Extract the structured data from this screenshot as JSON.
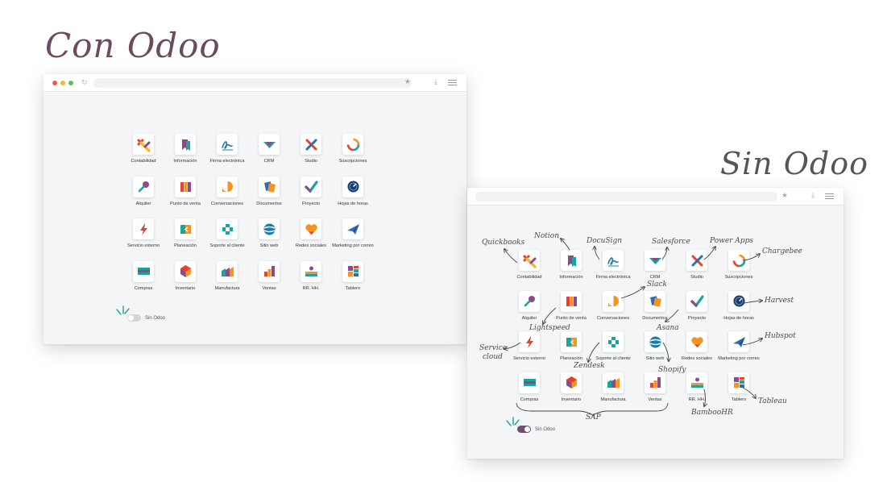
{
  "titles": {
    "con": "Con Odoo",
    "sin": "Sin Odoo"
  },
  "apps": [
    {
      "label": "Contabilidad",
      "icon": "contabilidad-icon"
    },
    {
      "label": "Información",
      "icon": "informacion-icon"
    },
    {
      "label": "Firma electrónica",
      "icon": "firma-electronica-icon"
    },
    {
      "label": "CRM",
      "icon": "crm-icon"
    },
    {
      "label": "Studio",
      "icon": "studio-icon"
    },
    {
      "label": "Suscripciones",
      "icon": "suscripciones-icon"
    },
    {
      "label": "Alquiler",
      "icon": "alquiler-icon"
    },
    {
      "label": "Punto de venta",
      "icon": "punto-de-venta-icon"
    },
    {
      "label": "Conversaciones",
      "icon": "conversaciones-icon"
    },
    {
      "label": "Documentos",
      "icon": "documentos-icon"
    },
    {
      "label": "Proyecto",
      "icon": "proyecto-icon"
    },
    {
      "label": "Hojas de horas",
      "icon": "hojas-de-horas-icon"
    },
    {
      "label": "Servicio externo",
      "icon": "servicio-externo-icon"
    },
    {
      "label": "Planeación",
      "icon": "planeacion-icon"
    },
    {
      "label": "Soporte al cliente",
      "icon": "soporte-al-cliente-icon"
    },
    {
      "label": "Sitio web",
      "icon": "sitio-web-icon"
    },
    {
      "label": "Redes sociales",
      "icon": "redes-sociales-icon"
    },
    {
      "label": "Marketing por correo",
      "icon": "marketing-por-correo-icon"
    },
    {
      "label": "Compras",
      "icon": "compras-icon"
    },
    {
      "label": "Inventario",
      "icon": "inventario-icon"
    },
    {
      "label": "Manufactura",
      "icon": "manufactura-icon"
    },
    {
      "label": "Ventas",
      "icon": "ventas-icon"
    },
    {
      "label": "RR. HH.",
      "icon": "rrhh-icon"
    },
    {
      "label": "Tablero",
      "icon": "tablero-icon"
    }
  ],
  "apps_sin_labels": {
    "Servicio externo": "Servicio externo",
    "Punto de venta": "Punto de venta",
    "Soporte al cliente": "Soporte al cliente"
  },
  "toggle": {
    "con_label": "Sin Odoo",
    "sin_label": "Sin Odoo",
    "con_state": "off",
    "sin_state": "on"
  },
  "tools": [
    {
      "name": "Quickbooks"
    },
    {
      "name": "Notion"
    },
    {
      "name": "DocuSign"
    },
    {
      "name": "Salesforce"
    },
    {
      "name": "Power Apps"
    },
    {
      "name": "Chargebee"
    },
    {
      "name": "Slack"
    },
    {
      "name": "Harvest"
    },
    {
      "name": "Lightspeed"
    },
    {
      "name": "Asana"
    },
    {
      "name": "Hubspot"
    },
    {
      "name": "Service"
    },
    {
      "name": "cloud"
    },
    {
      "name": "Zendesk"
    },
    {
      "name": "Shopify"
    },
    {
      "name": "SAP"
    },
    {
      "name": "BambooHR"
    },
    {
      "name": "Tableau"
    }
  ],
  "colors": {
    "title_con": "#6b4c5e",
    "title_sin": "#555555",
    "toggle_on": "#6f4f6f",
    "teal": "#1ba39c",
    "orange": "#f7931e",
    "purple": "#8c4a8c",
    "red": "#e9412d",
    "blue": "#2c6db4"
  }
}
